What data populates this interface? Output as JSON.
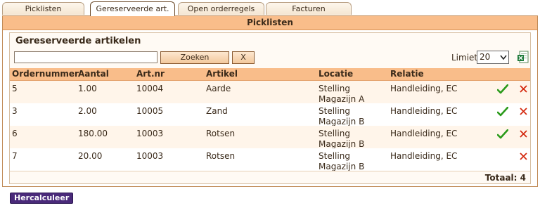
{
  "tabs": [
    {
      "label": "Picklisten"
    },
    {
      "label": "Gereserveerde art."
    },
    {
      "label": "Open orderregels"
    },
    {
      "label": "Facturen"
    }
  ],
  "panel": {
    "header": "Picklisten",
    "title": "Gereserveerde artikelen",
    "search": {
      "value": "",
      "placeholder": "",
      "search_label": "Zoeken",
      "clear_label": "X"
    },
    "limit": {
      "label": "Limiet",
      "value": "20"
    },
    "export_icon": "excel-icon",
    "columns": [
      "Ordernummer",
      "Aantal",
      "Art.nr",
      "Artikel",
      "Locatie",
      "Relatie"
    ],
    "rows": [
      {
        "ordernummer": "5",
        "aantal": "1.00",
        "artnr": "10004",
        "artikel": "Aarde",
        "locatie_1": "Stelling",
        "locatie_2": "Magazijn A",
        "relatie": "Handleiding, EC",
        "has_check": true
      },
      {
        "ordernummer": "3",
        "aantal": "2.00",
        "artnr": "10005",
        "artikel": "Zand",
        "locatie_1": "Stelling",
        "locatie_2": "Magazijn B",
        "relatie": "Handleiding, EC",
        "has_check": true
      },
      {
        "ordernummer": "6",
        "aantal": "180.00",
        "artnr": "10003",
        "artikel": "Rotsen",
        "locatie_1": "Stelling",
        "locatie_2": "Magazijn B",
        "relatie": "Handleiding, EC",
        "has_check": true
      },
      {
        "ordernummer": "7",
        "aantal": "20.00",
        "artnr": "10003",
        "artikel": "Rotsen",
        "locatie_1": "Stelling",
        "locatie_2": "Magazijn B",
        "relatie": "Handleiding, EC",
        "has_check": false
      }
    ],
    "total": "Totaal: 4"
  },
  "recalc_label": "Hercalculeer",
  "colors": {
    "header_bg": "#f9bd8a",
    "accent_check": "#2a9a1a",
    "delete_x": "#d42a10",
    "button_purple": "#4a2a7a"
  }
}
